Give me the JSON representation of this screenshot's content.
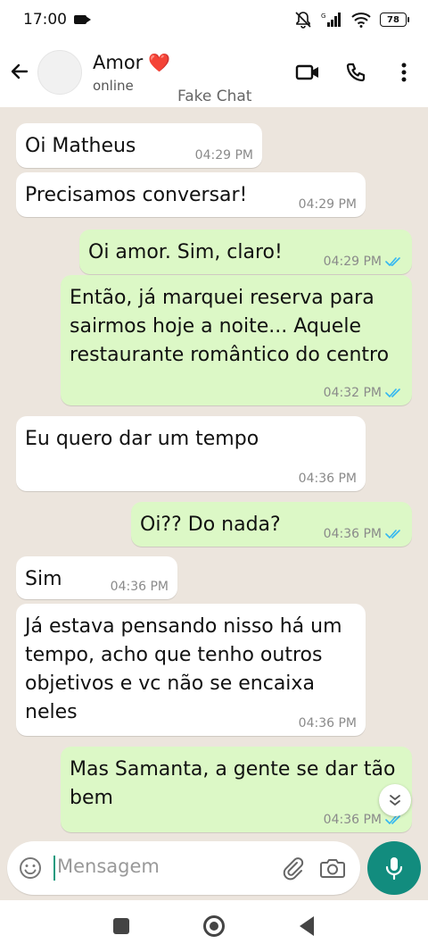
{
  "status_bar": {
    "time": "17:00",
    "battery": "78",
    "network": "G"
  },
  "contact": {
    "name": "Amor",
    "emoji": "❤️",
    "status": "online"
  },
  "watermark": "Fake Chat",
  "messages": [
    {
      "dir": "in",
      "text": "Oi Matheus",
      "time": "04:29 PM"
    },
    {
      "dir": "in",
      "text": "Precisamos conversar!",
      "time": "04:29 PM"
    },
    {
      "dir": "out",
      "text": "Oi amor. Sim, claro!",
      "time": "04:29 PM",
      "read": true
    },
    {
      "dir": "out",
      "text": "Então, já marquei reserva para sairmos hoje a noite... Aquele restaurante romântico do centro",
      "time": "04:32 PM",
      "read": true
    },
    {
      "dir": "in",
      "text": "Eu quero dar um tempo",
      "time": "04:36 PM"
    },
    {
      "dir": "out",
      "text": "Oi?? Do nada?",
      "time": "04:36 PM",
      "read": true
    },
    {
      "dir": "in",
      "text": "Sim",
      "time": "04:36 PM"
    },
    {
      "dir": "in",
      "text": "Já estava pensando nisso há um tempo, acho que tenho outros objetivos e vc não se encaixa neles",
      "time": "04:36 PM"
    },
    {
      "dir": "out",
      "text": "Mas Samanta, a gente se dar tão bem",
      "time": "04:36 PM",
      "read": true
    }
  ],
  "input": {
    "placeholder": "Mensagem"
  },
  "colors": {
    "incoming": "#ffffff",
    "outgoing": "#dcf8c6",
    "accent": "#128c7e",
    "read_ticks": "#34b7f1"
  },
  "icons": [
    "back-arrow-icon",
    "video-call-icon",
    "phone-icon",
    "more-vert-icon",
    "emoji-icon",
    "attach-icon",
    "camera-icon",
    "mic-icon",
    "scroll-down-icon"
  ]
}
